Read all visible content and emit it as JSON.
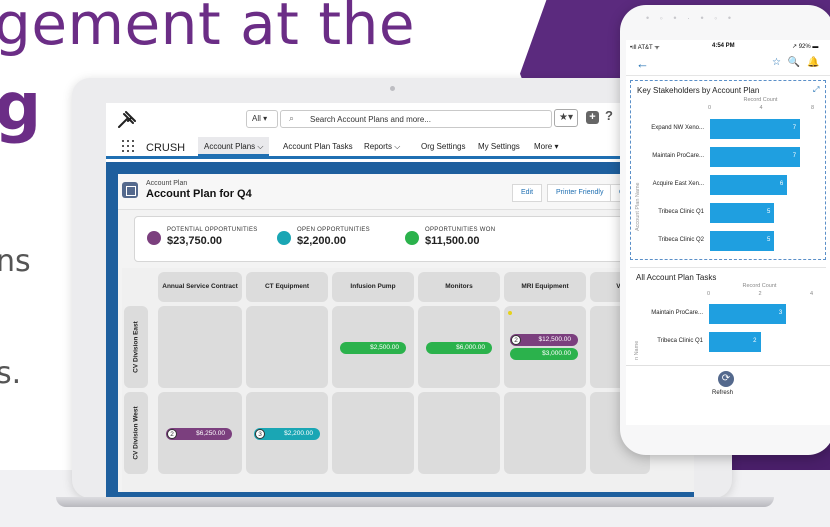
{
  "hero": {
    "line1": "gement at the",
    "line2": "g",
    "frag1": "ns",
    "frag2": "s."
  },
  "desktop": {
    "app_name": "CRUSH",
    "search_scope": "All ▾",
    "search_placeholder": "Search Account Plans and more...",
    "fav_glyph": "★▾",
    "plus_glyph": "+",
    "help_glyph": "?",
    "nav": [
      {
        "label": "Account Plans ⌵",
        "active": true
      },
      {
        "label": "Account Plan Tasks"
      },
      {
        "label": "Reports ⌵"
      },
      {
        "label": "Org Settings"
      },
      {
        "label": "My Settings"
      },
      {
        "label": "More ▾"
      }
    ],
    "record": {
      "type_label": "Account Plan",
      "title": "Account Plan for Q4",
      "buttons": [
        "Edit",
        "Printer Friendly",
        "Cl"
      ]
    },
    "kpis": [
      {
        "label": "POTENTIAL OPPORTUNITIES",
        "value": "$23,750.00",
        "color": "#7b3f7e"
      },
      {
        "label": "OPEN OPPORTUNITIES",
        "value": "$2,200.00",
        "color": "#1aa6b4"
      },
      {
        "label": "OPPORTUNITIES WON",
        "value": "$11,500.00",
        "color": "#2bb24c"
      }
    ],
    "columns": [
      "Annual Service Contract",
      "CT Equipment",
      "Infusion Pump",
      "Monitors",
      "MRI Equipment",
      "Ve"
    ],
    "rows": [
      "CV Division East",
      "CV Division West"
    ],
    "pills": {
      "east_infusion": "$2,500.00",
      "east_monitors": "$6,000.00",
      "east_mri_1_count": "2",
      "east_mri_1": "$12,500.00",
      "east_mri_2": "$3,000.00",
      "west_asc_count": "2",
      "west_asc": "$6,250.00",
      "west_ct_count": "3",
      "west_ct": "$2,200.00"
    },
    "colors": {
      "won": "#2bb24c",
      "potential": "#7b3f7e",
      "open": "#1aa6b4",
      "header_blue": "#1e5f9e"
    }
  },
  "mobile": {
    "carrier": "•ıll AT&T ᯤ",
    "time": "4:54 PM",
    "battery": "↗ 92% ▬",
    "back_glyph": "←",
    "nav_icons": "☆ 🔍 🔔",
    "refresh_label": "Refresh",
    "refresh_glyph": "⟳",
    "expand_glyph": "⤢"
  },
  "chart_data": [
    {
      "type": "bar",
      "orientation": "horizontal",
      "title": "Key Stakeholders by Account Plan",
      "xlabel": "Record Count",
      "ylabel": "Account Plan Name",
      "xlim": [
        0,
        8
      ],
      "xticks": [
        "0",
        "4",
        "8"
      ],
      "categories": [
        "Expand NW Xeno...",
        "Maintain ProCare...",
        "Acquire East Xen...",
        "Tribeca Clinic Q1",
        "Tribeca Clinic Q2"
      ],
      "values": [
        7,
        7,
        6,
        5,
        5
      ],
      "color": "#1f9fe0"
    },
    {
      "type": "bar",
      "orientation": "horizontal",
      "title": "All Account Plan Tasks",
      "xlabel": "Record Count",
      "ylabel": "n Name",
      "xlim": [
        0,
        4
      ],
      "xticks": [
        "0",
        "2",
        "4"
      ],
      "categories": [
        "Maintain ProCare...",
        "Tribeca Clinic Q1"
      ],
      "values": [
        3,
        2
      ],
      "color": "#1f9fe0"
    }
  ]
}
